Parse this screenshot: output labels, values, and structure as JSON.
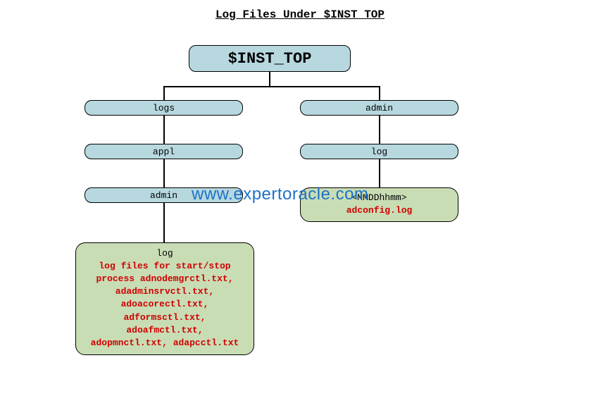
{
  "title": "Log Files Under $INST TOP",
  "root": {
    "label": "$INST_TOP"
  },
  "left": {
    "l1": {
      "label": "logs"
    },
    "l2": {
      "label": "appl"
    },
    "l3": {
      "label": "admin"
    },
    "leaf": {
      "label": "log",
      "content": "log files for start/stop\nprocess  adnodemgrctl.txt,\nadadminsrvctl.txt,\nadoacorectl.txt,\nadformsctl.txt,\nadoafmctl.txt,\nadopmnctl.txt, adapcctl.txt"
    }
  },
  "right": {
    "l1": {
      "label": "admin"
    },
    "l2": {
      "label": "log"
    },
    "leaf": {
      "label": "<MMDDhhmm>",
      "content": "adconfig.log"
    }
  },
  "watermark": "www.expertoracle.com"
}
